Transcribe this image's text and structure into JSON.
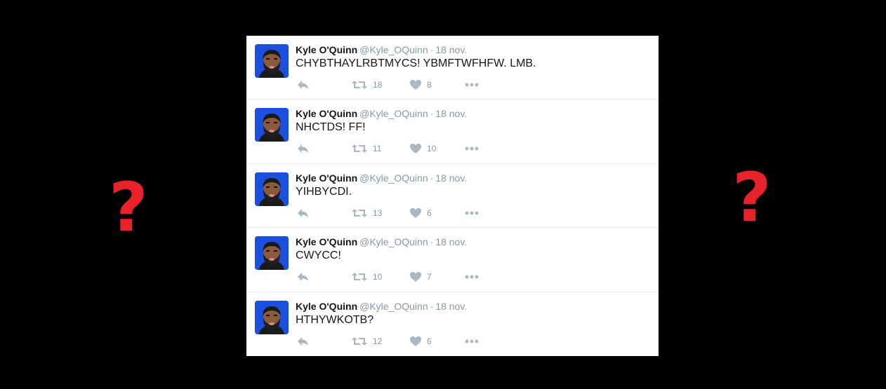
{
  "overlay": {
    "left_mark": "?",
    "right_mark": "?",
    "mark_color": "#e8212b"
  },
  "feed": {
    "tweets": [
      {
        "name": "Kyle O'Quinn",
        "handle": "@Kyle_OQuinn",
        "separator": "·",
        "date": "18 nov.",
        "text": "CHYBTHAYLRBTMYCS! YBMFTWFHFW. LMB.",
        "retweets": "18",
        "likes": "8"
      },
      {
        "name": "Kyle O'Quinn",
        "handle": "@Kyle_OQuinn",
        "separator": "·",
        "date": "18 nov.",
        "text": "NHCTDS! FF!",
        "retweets": "11",
        "likes": "10"
      },
      {
        "name": "Kyle O'Quinn",
        "handle": "@Kyle_OQuinn",
        "separator": "·",
        "date": "18 nov.",
        "text": "YIHBYCDI.",
        "retweets": "13",
        "likes": "6"
      },
      {
        "name": "Kyle O'Quinn",
        "handle": "@Kyle_OQuinn",
        "separator": "·",
        "date": "18 nov.",
        "text": "CWYCC!",
        "retweets": "10",
        "likes": "7"
      },
      {
        "name": "Kyle O'Quinn",
        "handle": "@Kyle_OQuinn",
        "separator": "·",
        "date": "18 nov.",
        "text": "HTHYWKOTB?",
        "retweets": "12",
        "likes": "6"
      }
    ],
    "icons": {
      "reply": "reply-icon",
      "retweet": "retweet-icon",
      "like": "heart-icon",
      "more": "more-icon"
    },
    "icon_color": "#aab8c2"
  }
}
